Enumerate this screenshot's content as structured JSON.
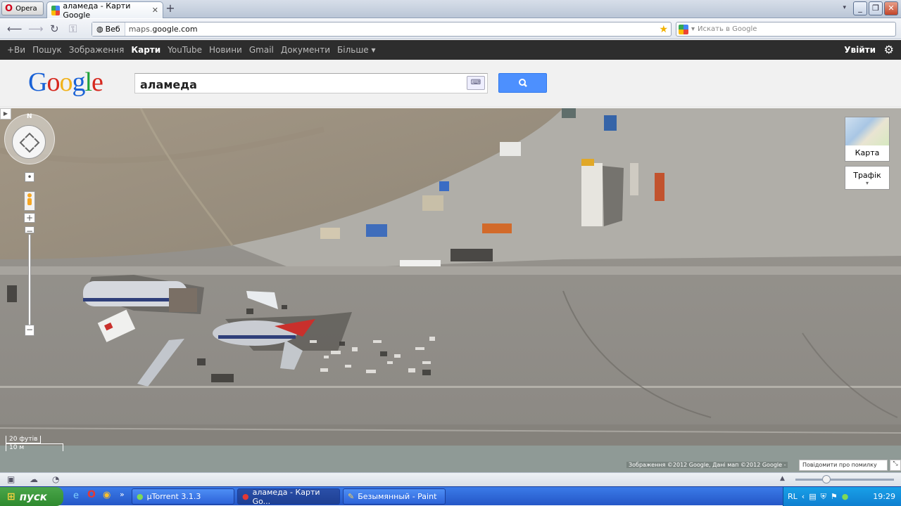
{
  "browser": {
    "menu_label": "Opera",
    "tab_title": "аламеда - Карти Google",
    "address_badge": "Веб",
    "address_host_prefix": "maps.",
    "address_host": "google.com",
    "search_placeholder": "Искать в Google"
  },
  "gbar": {
    "items": [
      "+Ви",
      "Пошук",
      "Зображення",
      "Карти",
      "YouTube",
      "Новини",
      "Gmail",
      "Документи",
      "Більше ▾"
    ],
    "active_index": 3,
    "sign_in": "Увійти"
  },
  "header": {
    "query": "аламеда"
  },
  "map": {
    "north": "N",
    "maptype_label": "Карта",
    "traffic_label": "Трафік",
    "scale_ft": "20 футів",
    "scale_m": "10 м",
    "attribution": "Зображення ©2012 Google, Дані мап ©2012 Google -",
    "report": "Повідомити про помилку"
  },
  "taskbar": {
    "start": "пуск",
    "tasks": [
      "µTorrent 3.1.3",
      "аламеда - Карти Go...",
      "Безымянный - Paint"
    ],
    "lang": "RL",
    "time": "19:29"
  },
  "colors": {
    "accent": "#4d90fe",
    "gbar_bg": "#2d2d2d",
    "taskbar": "#2456c7"
  }
}
